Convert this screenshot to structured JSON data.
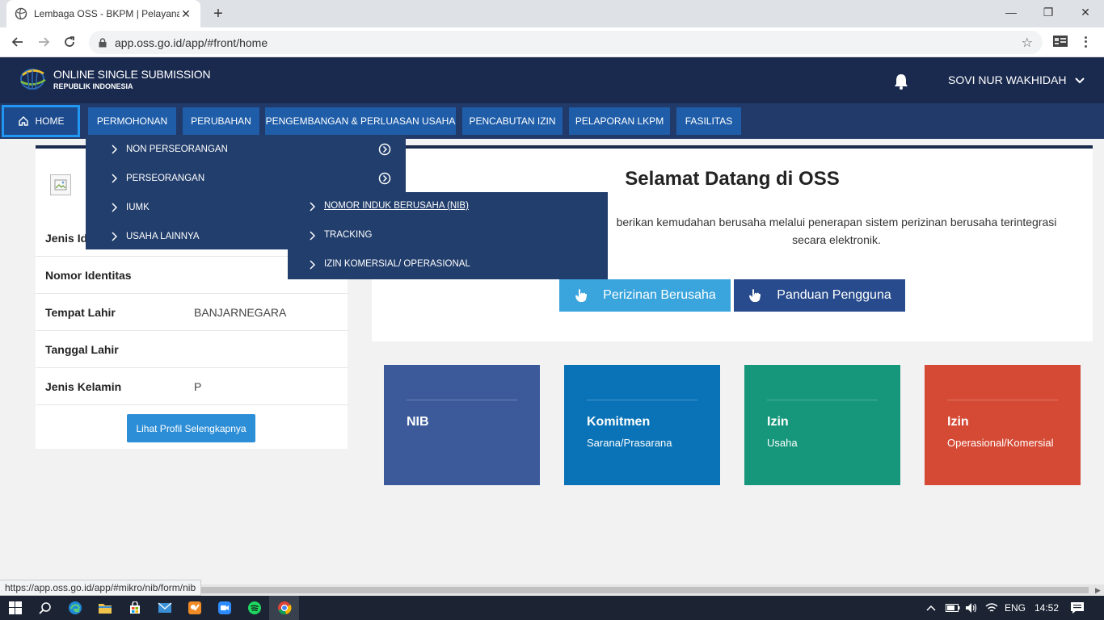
{
  "browser": {
    "tab_title": "Lembaga OSS - BKPM | Pelayanan",
    "tab_close": "✕",
    "new_tab": "+",
    "url": "app.oss.go.id/app/#front/home",
    "status_url": "https://app.oss.go.id/app/#mikro/nib/form/nib",
    "window_controls": {
      "minimize": "—",
      "restore": "❐",
      "close": "✕"
    }
  },
  "header": {
    "logo_title": "ONLINE SINGLE SUBMISSION",
    "logo_subtitle": "REPUBLIK INDONESIA",
    "user_name": "SOVI NUR WAKHIDAH",
    "icons": {
      "notification": "bell-icon",
      "user_menu": "chevron-down-icon"
    }
  },
  "nav": {
    "items": [
      {
        "label": "HOME"
      },
      {
        "label": "PERMOHONAN"
      },
      {
        "label": "PERUBAHAN"
      },
      {
        "label": "PENGEMBANGAN & PERLUASAN USAHA"
      },
      {
        "label": "PENCABUTAN IZIN"
      },
      {
        "label": "PELAPORAN LKPM"
      },
      {
        "label": "FASILITAS"
      }
    ]
  },
  "dropdown": {
    "items": [
      {
        "label": "NON PERSEORANGAN",
        "has_submenu": true
      },
      {
        "label": "PERSEORANGAN",
        "has_submenu": true
      },
      {
        "label": "IUMK",
        "has_submenu": false
      },
      {
        "label": "USAHA LAINNYA",
        "has_submenu": false
      }
    ],
    "submenu": [
      {
        "label": "NOMOR INDUK BERUSAHA (NIB)"
      },
      {
        "label": "TRACKING"
      },
      {
        "label": "IZIN KOMERSIAL/ OPERASIONAL"
      }
    ]
  },
  "profile": {
    "rows": [
      {
        "label": "Jenis Id",
        "value": ""
      },
      {
        "label": "Nomor Identitas",
        "value": ""
      },
      {
        "label": "Tempat Lahir",
        "value": "BANJARNEGARA"
      },
      {
        "label": "Tanggal Lahir",
        "value": ""
      },
      {
        "label": "Jenis Kelamin",
        "value": "P"
      }
    ],
    "button": "Lihat Profil Selengkapnya"
  },
  "welcome": {
    "title": "Selamat Datang di OSS",
    "desc_line1": "berikan kemudahan berusaha melalui penerapan sistem perizinan berusaha terintegrasi",
    "desc_line2": "secara elektronik.",
    "btn_perizinan": "Perizinan Berusaha",
    "btn_panduan": "Panduan Pengguna"
  },
  "tiles": [
    {
      "title": "NIB",
      "subtitle": "",
      "color": "#3c5a9a"
    },
    {
      "title": "Komitmen",
      "subtitle": "Sarana/Prasarana",
      "color": "#0a73b7"
    },
    {
      "title": "Izin",
      "subtitle": "Usaha",
      "color": "#16977b"
    },
    {
      "title": "Izin",
      "subtitle": "Operasional/Komersial",
      "color": "#d54a35"
    }
  ],
  "taskbar": {
    "lang": "ENG",
    "time": "14:52"
  },
  "colors": {
    "header_bg": "#1a2a4f",
    "nav_bg": "#213a6a",
    "nav_item": "#1f5da8",
    "dropdown_bg": "#223e6c",
    "accent_light": "#3aa4dd",
    "accent_dark": "#274b8c"
  }
}
